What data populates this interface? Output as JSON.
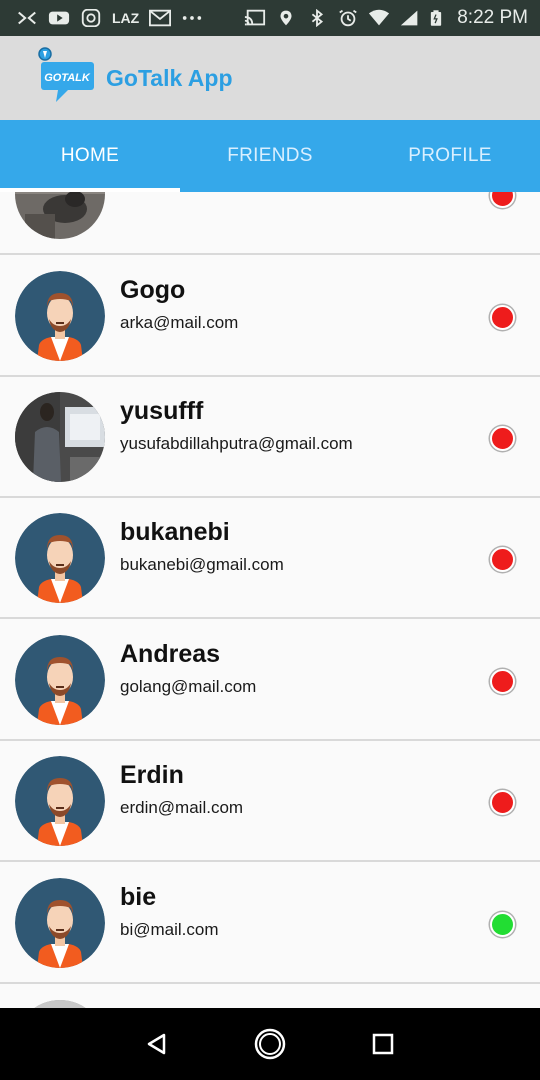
{
  "status_bar": {
    "time": "8:22 PM",
    "left_icons": [
      "mail-icon",
      "youtube-icon",
      "instagram-icon",
      "laz-icon",
      "gmail-icon",
      "more-icon"
    ],
    "laz_label": "LAZ",
    "right_icons": [
      "cast-icon",
      "location-icon",
      "bluetooth-icon",
      "alarm-icon",
      "wifi-icon",
      "signal-icon",
      "battery-icon"
    ]
  },
  "header": {
    "logo_text": "GOTALK",
    "title": "GoTalk App"
  },
  "tabs": [
    {
      "label": "HOME",
      "active": true
    },
    {
      "label": "FRIENDS",
      "active": false
    },
    {
      "label": "PROFILE",
      "active": false
    }
  ],
  "users": [
    {
      "name": "",
      "email": "",
      "avatar": "photo-avatar",
      "status": "offline",
      "status_color": "#ee1c1c"
    },
    {
      "name": "Gogo",
      "email": "arka@mail.com",
      "avatar": "default-avatar",
      "status": "offline",
      "status_color": "#ee1c1c"
    },
    {
      "name": "yusufff",
      "email": "yusufabdillahputra@gmail.com",
      "avatar": "photo-avatar",
      "status": "offline",
      "status_color": "#ee1c1c"
    },
    {
      "name": "bukanebi",
      "email": "bukanebi@gmail.com",
      "avatar": "default-avatar",
      "status": "offline",
      "status_color": "#ee1c1c"
    },
    {
      "name": "Andreas",
      "email": "golang@mail.com",
      "avatar": "default-avatar",
      "status": "offline",
      "status_color": "#ee1c1c"
    },
    {
      "name": "Erdin",
      "email": "erdin@mail.com",
      "avatar": "default-avatar",
      "status": "offline",
      "status_color": "#ee1c1c"
    },
    {
      "name": "bie",
      "email": "bi@mail.com",
      "avatar": "default-avatar",
      "status": "online",
      "status_color": "#22dd33"
    }
  ],
  "nav_bar": {
    "buttons": [
      "back-icon",
      "home-icon",
      "recents-icon"
    ]
  },
  "colors": {
    "accent": "#35a8ea",
    "title": "#2c9fe2",
    "offline": "#ee1c1c",
    "online": "#22dd33"
  }
}
